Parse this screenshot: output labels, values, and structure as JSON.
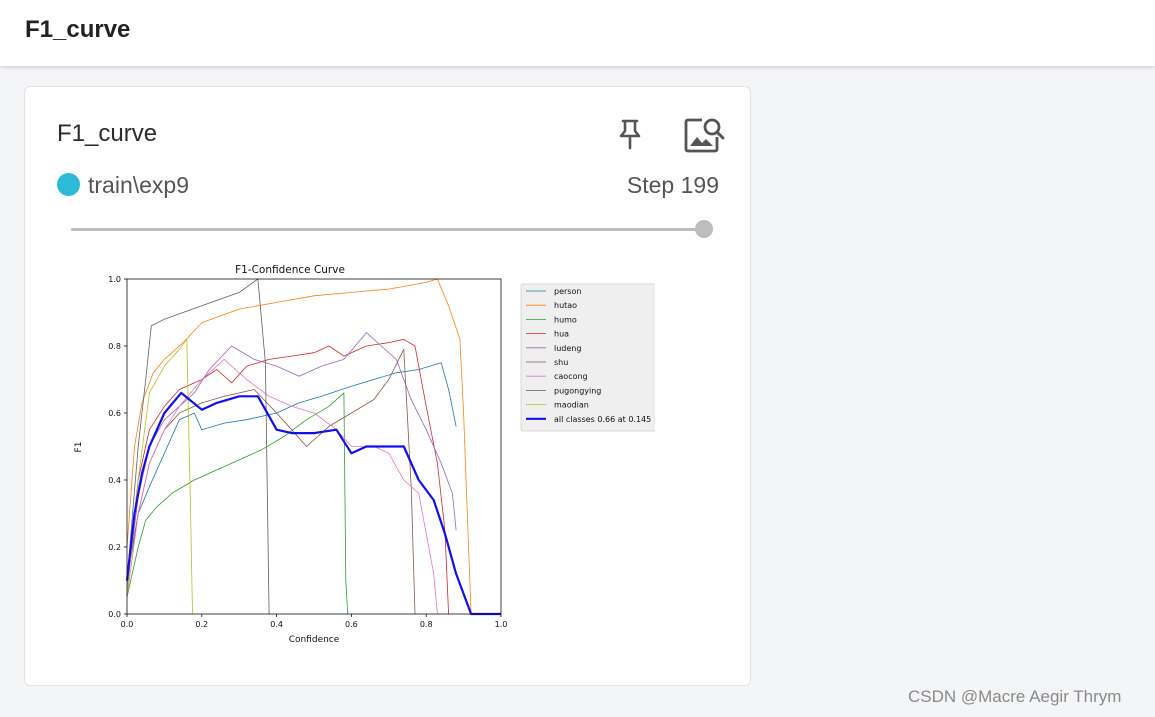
{
  "header": {
    "title": "F1_curve"
  },
  "card": {
    "title": "F1_curve",
    "run_name": "train\\exp9",
    "step_text": "Step 199",
    "run_color": "#2cbad6",
    "pin_icon": "pin-icon",
    "image_icon": "image-search-icon"
  },
  "watermark": "CSDN @Macre Aegir Thrym",
  "chart_data": {
    "type": "line",
    "title": "F1-Confidence Curve",
    "xlabel": "Confidence",
    "ylabel": "F1",
    "xlim": [
      0,
      1
    ],
    "ylim": [
      0,
      1
    ],
    "xticks": [
      "0.0",
      "0.2",
      "0.4",
      "0.6",
      "0.8",
      "1.0"
    ],
    "yticks": [
      "0.0",
      "0.2",
      "0.4",
      "0.6",
      "0.8",
      "1.0"
    ],
    "legend_position": "outside-right",
    "series": [
      {
        "name": "person",
        "color": "#1f77b4",
        "width": 0.8,
        "points": [
          [
            0,
            0.1
          ],
          [
            0.03,
            0.3
          ],
          [
            0.06,
            0.38
          ],
          [
            0.1,
            0.48
          ],
          [
            0.14,
            0.58
          ],
          [
            0.18,
            0.6
          ],
          [
            0.2,
            0.55
          ],
          [
            0.26,
            0.57
          ],
          [
            0.32,
            0.58
          ],
          [
            0.4,
            0.6
          ],
          [
            0.46,
            0.63
          ],
          [
            0.52,
            0.65
          ],
          [
            0.6,
            0.68
          ],
          [
            0.66,
            0.7
          ],
          [
            0.72,
            0.72
          ],
          [
            0.78,
            0.73
          ],
          [
            0.84,
            0.75
          ],
          [
            0.86,
            0.67
          ],
          [
            0.88,
            0.56
          ]
        ]
      },
      {
        "name": "hutao",
        "color": "#ff7f0e",
        "width": 0.8,
        "points": [
          [
            0,
            0.2
          ],
          [
            0.02,
            0.5
          ],
          [
            0.04,
            0.63
          ],
          [
            0.07,
            0.72
          ],
          [
            0.1,
            0.76
          ],
          [
            0.15,
            0.81
          ],
          [
            0.2,
            0.87
          ],
          [
            0.3,
            0.91
          ],
          [
            0.4,
            0.93
          ],
          [
            0.5,
            0.95
          ],
          [
            0.6,
            0.96
          ],
          [
            0.7,
            0.97
          ],
          [
            0.8,
            0.99
          ],
          [
            0.83,
            1.0
          ],
          [
            0.86,
            0.92
          ],
          [
            0.89,
            0.82
          ],
          [
            0.9,
            0.6
          ],
          [
            0.91,
            0.3
          ],
          [
            0.92,
            0
          ]
        ]
      },
      {
        "name": "humo",
        "color": "#2ca02c",
        "width": 0.8,
        "points": [
          [
            0,
            0.05
          ],
          [
            0.03,
            0.2
          ],
          [
            0.05,
            0.28
          ],
          [
            0.08,
            0.32
          ],
          [
            0.12,
            0.36
          ],
          [
            0.18,
            0.4
          ],
          [
            0.24,
            0.43
          ],
          [
            0.3,
            0.46
          ],
          [
            0.36,
            0.49
          ],
          [
            0.42,
            0.53
          ],
          [
            0.48,
            0.58
          ],
          [
            0.54,
            0.62
          ],
          [
            0.58,
            0.66
          ],
          [
            0.585,
            0.1
          ],
          [
            0.59,
            0
          ]
        ]
      },
      {
        "name": "hua",
        "color": "#d62728",
        "width": 0.8,
        "points": [
          [
            0,
            0.1
          ],
          [
            0.03,
            0.4
          ],
          [
            0.06,
            0.55
          ],
          [
            0.1,
            0.62
          ],
          [
            0.14,
            0.67
          ],
          [
            0.2,
            0.7
          ],
          [
            0.24,
            0.73
          ],
          [
            0.28,
            0.69
          ],
          [
            0.32,
            0.74
          ],
          [
            0.38,
            0.76
          ],
          [
            0.44,
            0.77
          ],
          [
            0.5,
            0.78
          ],
          [
            0.54,
            0.8
          ],
          [
            0.58,
            0.77
          ],
          [
            0.64,
            0.8
          ],
          [
            0.7,
            0.81
          ],
          [
            0.74,
            0.82
          ],
          [
            0.77,
            0.8
          ],
          [
            0.8,
            0.62
          ],
          [
            0.83,
            0.45
          ],
          [
            0.85,
            0.25
          ],
          [
            0.86,
            0
          ]
        ]
      },
      {
        "name": "ludeng",
        "color": "#9467bd",
        "width": 0.8,
        "points": [
          [
            0,
            0.08
          ],
          [
            0.03,
            0.35
          ],
          [
            0.06,
            0.5
          ],
          [
            0.1,
            0.58
          ],
          [
            0.14,
            0.62
          ],
          [
            0.18,
            0.66
          ],
          [
            0.22,
            0.73
          ],
          [
            0.28,
            0.8
          ],
          [
            0.34,
            0.76
          ],
          [
            0.4,
            0.74
          ],
          [
            0.46,
            0.71
          ],
          [
            0.52,
            0.74
          ],
          [
            0.58,
            0.76
          ],
          [
            0.64,
            0.84
          ],
          [
            0.68,
            0.8
          ],
          [
            0.72,
            0.76
          ],
          [
            0.76,
            0.64
          ],
          [
            0.8,
            0.55
          ],
          [
            0.84,
            0.45
          ],
          [
            0.87,
            0.36
          ],
          [
            0.88,
            0.25
          ]
        ]
      },
      {
        "name": "shu",
        "color": "#8c564b",
        "width": 0.8,
        "points": [
          [
            0,
            0.1
          ],
          [
            0.03,
            0.3
          ],
          [
            0.06,
            0.45
          ],
          [
            0.1,
            0.55
          ],
          [
            0.14,
            0.6
          ],
          [
            0.2,
            0.63
          ],
          [
            0.26,
            0.65
          ],
          [
            0.34,
            0.67
          ],
          [
            0.4,
            0.6
          ],
          [
            0.44,
            0.55
          ],
          [
            0.48,
            0.5
          ],
          [
            0.54,
            0.56
          ],
          [
            0.6,
            0.6
          ],
          [
            0.66,
            0.64
          ],
          [
            0.7,
            0.7
          ],
          [
            0.74,
            0.79
          ],
          [
            0.76,
            0.38
          ],
          [
            0.77,
            0
          ]
        ]
      },
      {
        "name": "caocong",
        "color": "#e377c2",
        "width": 0.8,
        "points": [
          [
            0,
            0.05
          ],
          [
            0.03,
            0.3
          ],
          [
            0.06,
            0.45
          ],
          [
            0.1,
            0.55
          ],
          [
            0.14,
            0.62
          ],
          [
            0.2,
            0.7
          ],
          [
            0.26,
            0.76
          ],
          [
            0.32,
            0.7
          ],
          [
            0.38,
            0.65
          ],
          [
            0.44,
            0.62
          ],
          [
            0.5,
            0.6
          ],
          [
            0.56,
            0.55
          ],
          [
            0.6,
            0.5
          ],
          [
            0.66,
            0.5
          ],
          [
            0.7,
            0.48
          ],
          [
            0.74,
            0.4
          ],
          [
            0.78,
            0.36
          ],
          [
            0.82,
            0.12
          ],
          [
            0.83,
            0
          ]
        ]
      },
      {
        "name": "pugongying",
        "color": "#606060",
        "width": 0.8,
        "points": [
          [
            0,
            0.1
          ],
          [
            0.03,
            0.5
          ],
          [
            0.05,
            0.7
          ],
          [
            0.065,
            0.86
          ],
          [
            0.1,
            0.88
          ],
          [
            0.2,
            0.92
          ],
          [
            0.3,
            0.96
          ],
          [
            0.35,
            1.0
          ],
          [
            0.37,
            0.75
          ],
          [
            0.38,
            0
          ]
        ]
      },
      {
        "name": "maodian",
        "color": "#bcbd22",
        "width": 0.8,
        "points": [
          [
            0,
            0.05
          ],
          [
            0.03,
            0.4
          ],
          [
            0.06,
            0.66
          ],
          [
            0.1,
            0.74
          ],
          [
            0.14,
            0.79
          ],
          [
            0.16,
            0.82
          ],
          [
            0.17,
            0.3
          ],
          [
            0.175,
            0
          ]
        ]
      },
      {
        "name": "all classes 0.66 at 0.145",
        "color": "#1010ee",
        "width": 2.2,
        "points": [
          [
            0,
            0.1
          ],
          [
            0.02,
            0.3
          ],
          [
            0.04,
            0.42
          ],
          [
            0.06,
            0.5
          ],
          [
            0.1,
            0.6
          ],
          [
            0.145,
            0.66
          ],
          [
            0.2,
            0.61
          ],
          [
            0.24,
            0.63
          ],
          [
            0.3,
            0.65
          ],
          [
            0.35,
            0.65
          ],
          [
            0.4,
            0.55
          ],
          [
            0.44,
            0.54
          ],
          [
            0.5,
            0.54
          ],
          [
            0.56,
            0.55
          ],
          [
            0.6,
            0.48
          ],
          [
            0.64,
            0.5
          ],
          [
            0.7,
            0.5
          ],
          [
            0.74,
            0.5
          ],
          [
            0.78,
            0.4
          ],
          [
            0.82,
            0.34
          ],
          [
            0.85,
            0.24
          ],
          [
            0.88,
            0.12
          ],
          [
            0.92,
            0
          ],
          [
            1.0,
            0
          ]
        ]
      }
    ]
  }
}
